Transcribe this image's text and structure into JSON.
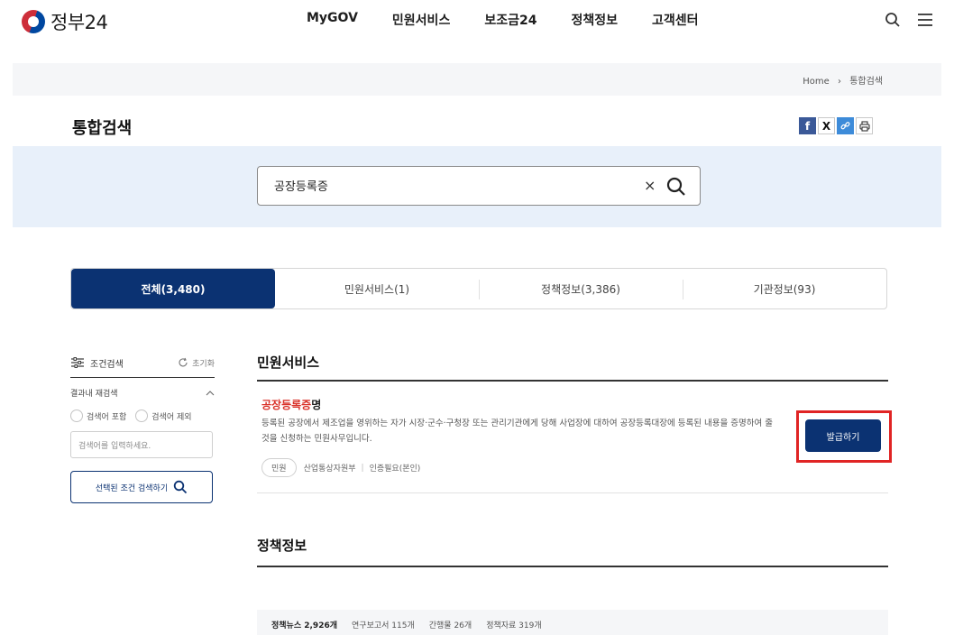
{
  "header": {
    "logo_text": "정부24",
    "nav": [
      "MyGOV",
      "민원서비스",
      "보조금24",
      "정책정보",
      "고객센터"
    ],
    "icons": [
      "search-icon",
      "menu-icon"
    ]
  },
  "breadcrumb": {
    "home": "Home",
    "separator": "›",
    "current": "통합검색"
  },
  "page": {
    "title": "통합검색"
  },
  "share": {
    "x_label": "X",
    "icons": [
      "facebook-icon",
      "x-icon",
      "link-icon",
      "print-icon"
    ]
  },
  "search": {
    "value": "공장등록증",
    "clear_label": "×"
  },
  "tabs": [
    {
      "label": "전체(3,480)",
      "active": true
    },
    {
      "label": "민원서비스(1)",
      "active": false
    },
    {
      "label": "정책정보(3,386)",
      "active": false
    },
    {
      "label": "기관정보(93)",
      "active": false
    }
  ],
  "sidebar": {
    "filter_label": "조건검색",
    "reset_label": "초기화",
    "refine_label": "결과내 재검색",
    "options": [
      "검색어 포함",
      "검색어 제외"
    ],
    "input_placeholder": "검색어를 입력하세요.",
    "search_button": "선택된 조건 검색하기"
  },
  "sections": {
    "civil": {
      "title": "민원서비스",
      "result": {
        "title_highlight": "공장등록증",
        "title_rest": "명",
        "description": "등록된 공장에서 제조업을 영위하는 자가 시장·군수·구청장 또는 관리기관에게 당해 사업장에 대하여 공장등록대장에 등록된 내용을 증명하여 줄 것을 신청하는 민원사무입니다.",
        "badge": "민원",
        "agency": "산업통상자원부",
        "auth": "인증필요(본인)",
        "action_button": "발급하기"
      }
    },
    "policy": {
      "title": "정책정보",
      "stats": [
        "정책뉴스 2,926개",
        "연구보고서 115개",
        "간행물 26개",
        "정책자료 319개"
      ]
    }
  },
  "colors": {
    "primary": "#0b3272",
    "highlight": "#d9322a",
    "annotation_box": "#e02424"
  }
}
